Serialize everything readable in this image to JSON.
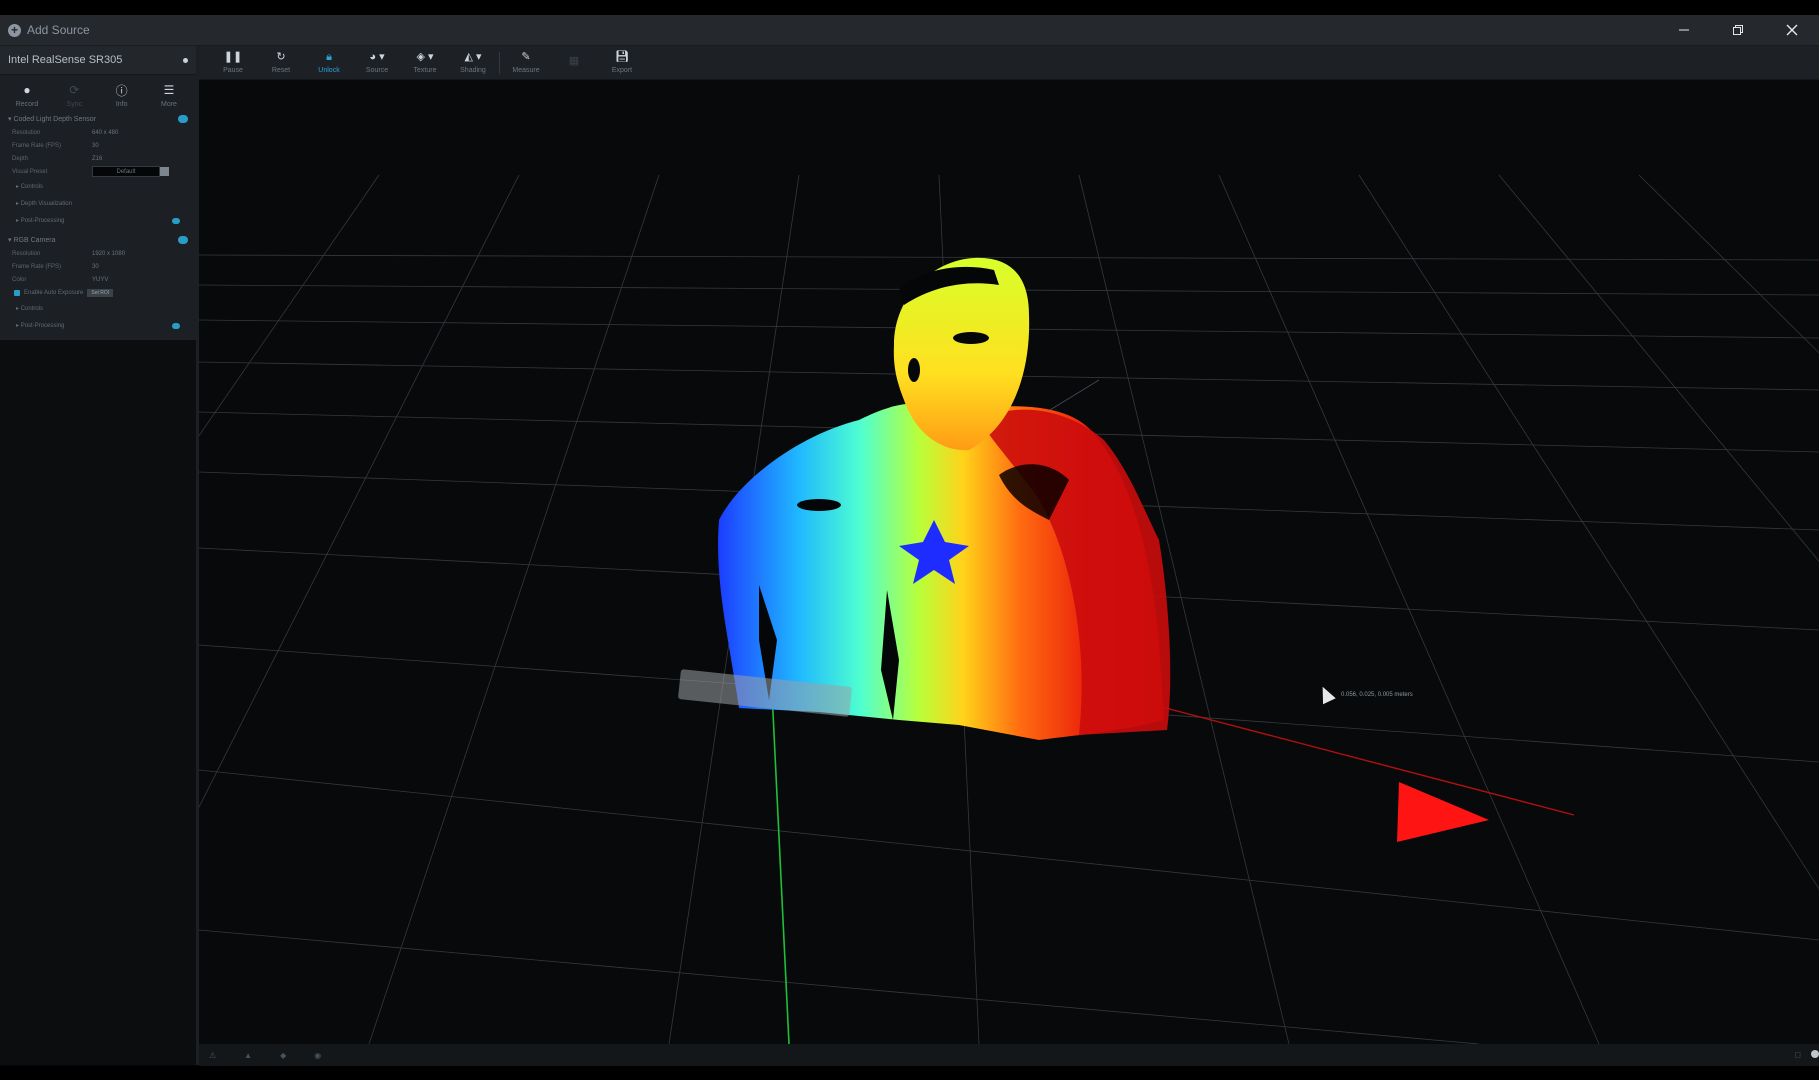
{
  "titlebar": {
    "add_source_label": "Add Source",
    "window_icons": [
      "minimize-icon",
      "restore-icon",
      "close-icon"
    ]
  },
  "device": {
    "name": "Intel RealSense SR305",
    "actions": [
      {
        "label": "Record",
        "icon": "record-icon",
        "enabled": true
      },
      {
        "label": "Sync",
        "icon": "sync-icon",
        "enabled": false
      },
      {
        "label": "Info",
        "icon": "info-icon",
        "enabled": true
      },
      {
        "label": "More",
        "icon": "menu-icon",
        "enabled": true
      }
    ],
    "depth_sensor": {
      "title": "Coded Light Depth Sensor",
      "resolution_label": "Resolution",
      "resolution_value": "640 x 480",
      "frame_rate_label": "Frame Rate (FPS)",
      "frame_rate_value": "30",
      "format_label": "Depth",
      "format_value": "Z16",
      "preset_label": "Visual Preset",
      "preset_value": "Default",
      "sub_controls": "Controls",
      "sub_depth_vis": "Depth Visualization",
      "sub_post_processing": "Post-Processing"
    },
    "rgb_camera": {
      "title": "RGB Camera",
      "resolution_label": "Resolution",
      "resolution_value": "1920 x 1080",
      "frame_rate_label": "Frame Rate (FPS)",
      "frame_rate_value": "30",
      "format_label": "Color",
      "format_value": "YUYV",
      "auto_exposure_label": "Enable Auto Exposure",
      "set_roi_label": "Set ROI",
      "sub_controls": "Controls",
      "sub_post_processing": "Post-Processing"
    }
  },
  "toolbar": {
    "tools": [
      {
        "label": "Pause",
        "icon": "pause-icon"
      },
      {
        "label": "Reset",
        "icon": "reset-icon"
      },
      {
        "label": "Unlock",
        "icon": "lock-icon",
        "active": true
      },
      {
        "label": "Source",
        "icon": "source-icon"
      },
      {
        "label": "Texture",
        "icon": "texture-icon"
      },
      {
        "label": "Shading",
        "icon": "shading-icon"
      },
      {
        "label": "Measure",
        "icon": "ruler-icon"
      },
      {
        "label": "",
        "icon": "grid-icon",
        "disabled": true
      },
      {
        "label": "Export",
        "icon": "save-icon"
      }
    ]
  },
  "viewport": {
    "coordinate_readout": "0.056, 0.025, 0.005 meters",
    "axis_colors": {
      "x": "#ff1414",
      "y": "#1fbf3a",
      "z": "#1530ff"
    }
  },
  "colors": {
    "accent": "#2aa4d8",
    "panel_bg": "#1c1f23",
    "titlebar_bg": "#25292e"
  }
}
